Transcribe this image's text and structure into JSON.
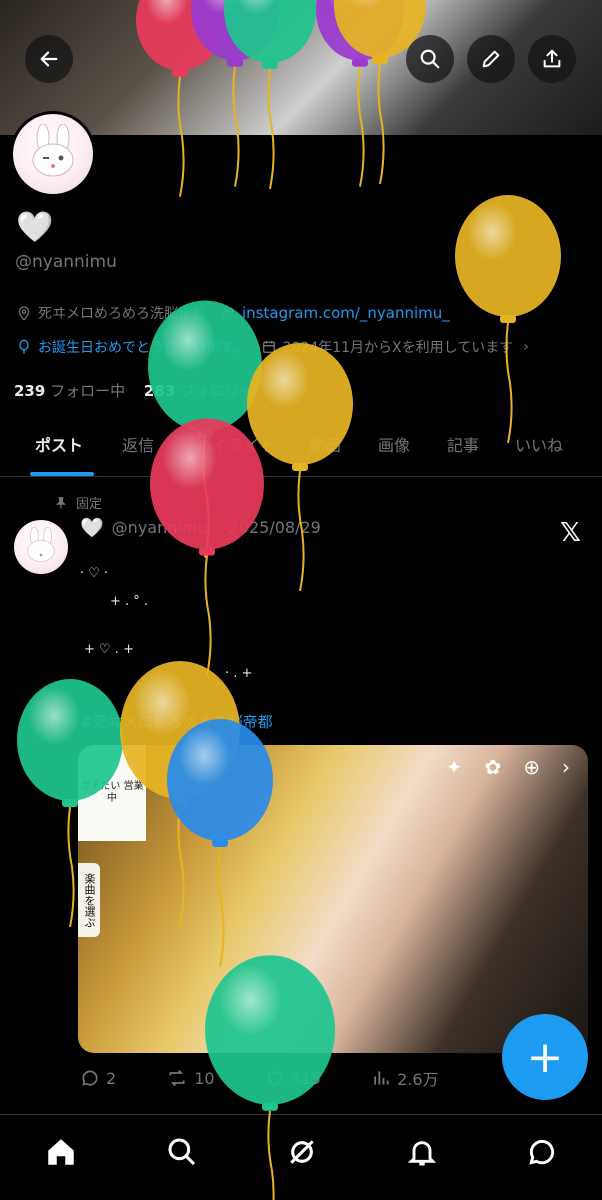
{
  "header": {
    "back_icon": "arrow-left-icon",
    "search_icon": "search-icon",
    "edit_icon": "pencil-icon",
    "share_icon": "share-icon"
  },
  "profile": {
    "display_name": "🤍",
    "handle": "@nyannimu",
    "location": "死ヰメロめろめろ洗脳帝都",
    "website": "instagram.com/_nyannimu_",
    "birthday": "お誕生日おめでとうございます。",
    "joined": "2024年11月からXを利用しています",
    "following_count": "239",
    "following_label": "フォロー中",
    "followers_count": "283",
    "followers_label": "フォロワー"
  },
  "tabs": [
    "ポスト",
    "返信",
    "ハイライト",
    "動画",
    "画像",
    "記事",
    "いいね"
  ],
  "post": {
    "pinned_label": "固定",
    "author_name": "🤍",
    "author_handle": "@nyannimu",
    "date": "2025/08/29",
    "deco_lines": [
      "·  ♡  ·",
      "+ .  °   .",
      "+  ♡  .  +",
      "· .  +"
    ],
    "hashtag": "#死ヰメロめろめろ洗脳帝都",
    "media": {
      "sticker_text": "ガチたい 営業中",
      "music_label": "楽曲を選ぶ"
    },
    "replies": "2",
    "reposts": "10",
    "likes": "315",
    "views": "2.6万"
  },
  "bottom_nav": [
    "home-icon",
    "search-icon",
    "grok-icon",
    "notifications-icon",
    "messages-icon"
  ],
  "colors": {
    "accent": "#1d9bf0",
    "balloon_green": "#1fc58f",
    "balloon_yellow": "#e6b422",
    "balloon_red": "#e83a5a",
    "balloon_blue": "#2a8be8",
    "balloon_purple": "#9a3ad0",
    "balloon_pink": "#ea3b8a"
  }
}
